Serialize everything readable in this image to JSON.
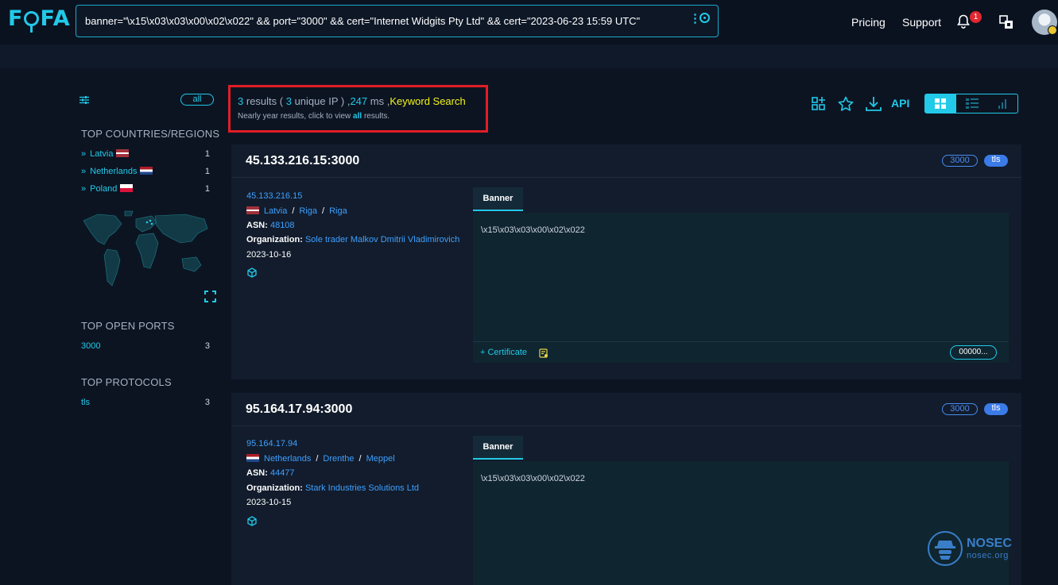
{
  "header": {
    "logo": "FOFA",
    "query": "banner=\"\\x15\\x03\\x03\\x00\\x02\\x022\" && port=\"3000\" && cert=\"Internet Widgits Pty Ltd\" && cert=\"2023-06-23 15:59 UTC\"",
    "search_dots": "⋮",
    "nav": {
      "pricing": "Pricing",
      "support": "Support"
    },
    "notifications": "1"
  },
  "sidebar": {
    "all_label": "all",
    "countries_title": "TOP COUNTRIES/REGIONS",
    "countries": [
      {
        "name": "Latvia",
        "count": "1",
        "flag": "lv"
      },
      {
        "name": "Netherlands",
        "count": "1",
        "flag": "nl"
      },
      {
        "name": "Poland",
        "count": "1",
        "flag": "pl"
      }
    ],
    "ports_title": "TOP OPEN PORTS",
    "ports": [
      {
        "name": "3000",
        "count": "3"
      }
    ],
    "protocols_title": "TOP PROTOCOLS",
    "protocols": [
      {
        "name": "tls",
        "count": "3"
      }
    ]
  },
  "summary": {
    "count": "3",
    "results_word": "results (",
    "unique": "3",
    "unique_word": "unique IP ) ,",
    "ms_value": "247",
    "ms_word": "ms ,",
    "keyword": "Keyword Search",
    "sub_prefix": "Nearly year results, click to view",
    "sub_all": "all",
    "sub_suffix": "results."
  },
  "toolbar": {
    "api_label": "API"
  },
  "results": [
    {
      "title": "45.133.216.15:3000",
      "port": "3000",
      "protocol": "tls",
      "ip": "45.133.216.15",
      "country": "Latvia",
      "region": "Riga",
      "city": "Riga",
      "asn_label": "ASN:",
      "asn": "48108",
      "org_label": "Organization:",
      "org": "Sole trader Malkov Dmitrii Vladimirovich",
      "date": "2023-10-16",
      "banner_tab": "Banner",
      "banner": "\\x15\\x03\\x03\\x00\\x02\\x022",
      "cert_label": "+ Certificate",
      "hash": "00000..."
    },
    {
      "title": "95.164.17.94:3000",
      "port": "3000",
      "protocol": "tls",
      "ip": "95.164.17.94",
      "country": "Netherlands",
      "region": "Drenthe",
      "city": "Meppel",
      "asn_label": "ASN:",
      "asn": "44477",
      "org_label": "Organization:",
      "org": "Stark Industries Solutions Ltd",
      "date": "2023-10-15",
      "banner_tab": "Banner",
      "banner": "\\x15\\x03\\x03\\x00\\x02\\x022"
    }
  ],
  "watermark": {
    "name": "NOSEC",
    "site": "nosec.org"
  }
}
